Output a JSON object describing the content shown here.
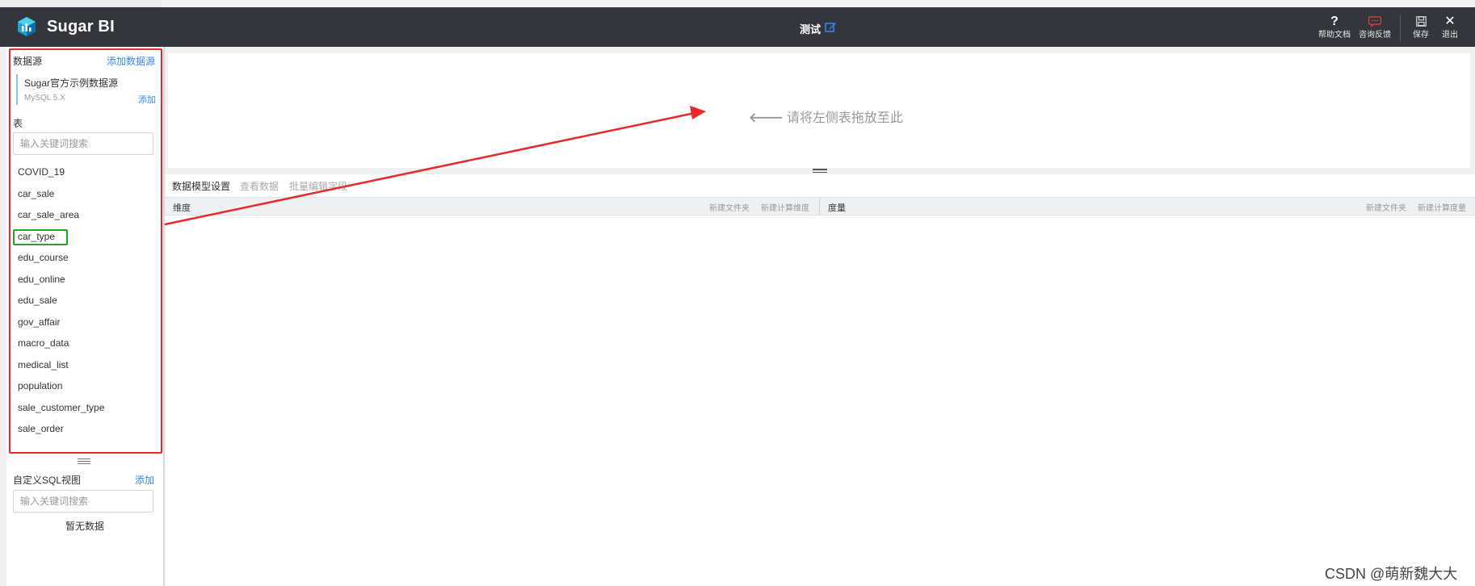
{
  "app": {
    "brand": "Sugar BI"
  },
  "document": {
    "title": "测试"
  },
  "toolbar": {
    "help_label": "帮助文档",
    "feedback_label": "咨询反馈",
    "save_label": "保存",
    "exit_label": "退出"
  },
  "datasource": {
    "section_label": "数据源",
    "add_source_label": "添加数据源",
    "name": "Sugar官方示例数据源",
    "type": "MySQL 5.X",
    "add_label": "添加"
  },
  "tables": {
    "section_label": "表",
    "search_placeholder": "输入关键词搜索",
    "items": [
      "COVID_19",
      "car_sale",
      "car_sale_area",
      "car_type",
      "edu_course",
      "edu_online",
      "edu_sale",
      "gov_affair",
      "macro_data",
      "medical_list",
      "population",
      "sale_customer_type",
      "sale_order"
    ],
    "highlighted": "car_type"
  },
  "sql_views": {
    "section_label": "自定义SQL视图",
    "add_label": "添加",
    "search_placeholder": "输入关键词搜索",
    "empty_text": "暂无数据"
  },
  "canvas": {
    "drop_hint": "请将左侧表拖放至此"
  },
  "tabs": [
    {
      "label": "数据模型设置",
      "state": "active"
    },
    {
      "label": "查看数据",
      "state": "disabled"
    },
    {
      "label": "批量编辑字段",
      "state": "disabled"
    }
  ],
  "fields": {
    "dimension": {
      "title": "维度",
      "new_folder": "新建文件夹",
      "new_calc": "新建计算维度"
    },
    "measure": {
      "title": "度量",
      "new_folder": "新建文件夹",
      "new_calc": "新建计算度量"
    }
  },
  "watermark": "CSDN @萌新魏大大",
  "colors": {
    "topbar": "#33363d",
    "link": "#2f88e8",
    "annotation_red": "#e8292b",
    "annotation_green": "#1fa81f"
  }
}
